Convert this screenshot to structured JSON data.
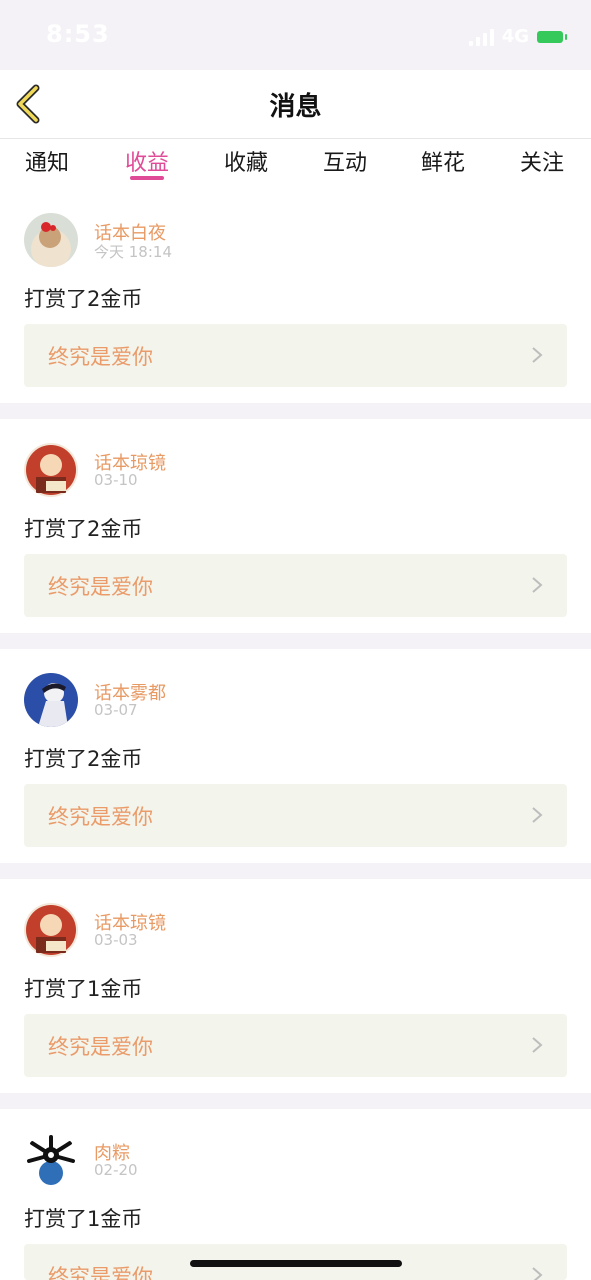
{
  "status_bar": {
    "time": "8:53",
    "network": "4G",
    "battery_color": "#35c85a"
  },
  "header": {
    "back_icon": "chevron-left-icon",
    "title": "消息"
  },
  "tabs": [
    {
      "label": "通知",
      "active": false
    },
    {
      "label": "收益",
      "active": true
    },
    {
      "label": "收藏",
      "active": false
    },
    {
      "label": "互动",
      "active": false
    },
    {
      "label": "鲜花",
      "active": false
    },
    {
      "label": "关注",
      "active": false
    }
  ],
  "colors": {
    "accent": "#e04b98",
    "username": "#e89a64",
    "work_title": "#ea9b69",
    "work_link_bg": "#f3f4ec"
  },
  "messages": [
    {
      "username": "话本白夜",
      "date": "今天 18:14",
      "text": "打赏了2金币",
      "work_title": "终究是爱你"
    },
    {
      "username": "话本琼镜",
      "date": "03-10",
      "text": "打赏了2金币",
      "work_title": "终究是爱你"
    },
    {
      "username": "话本雾都",
      "date": "03-07",
      "text": "打赏了2金币",
      "work_title": "终究是爱你"
    },
    {
      "username": "话本琼镜",
      "date": "03-03",
      "text": "打赏了1金币",
      "work_title": "终究是爱你"
    },
    {
      "username": "肉粽",
      "date": "02-20",
      "text": "打赏了1金币",
      "work_title": "终究是爱你"
    }
  ]
}
